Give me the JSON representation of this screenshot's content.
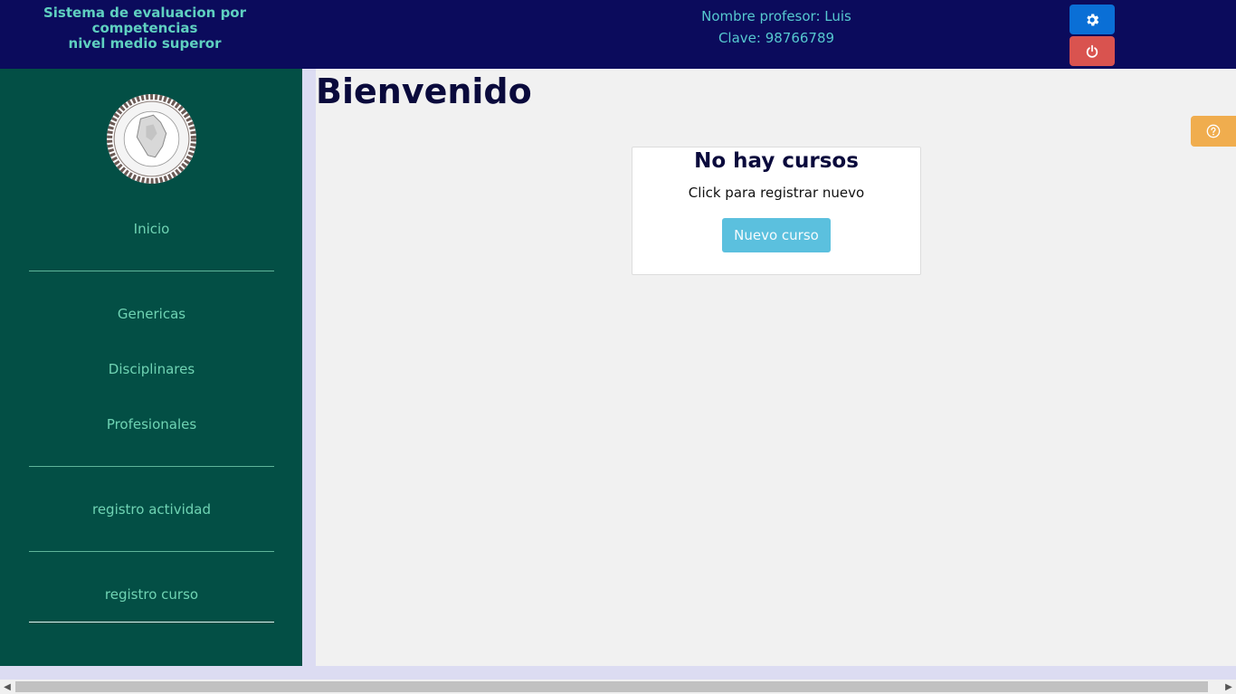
{
  "header": {
    "app_title_line1": "Sistema de evaluacion por competencias",
    "app_title_line2": "nivel medio superor",
    "teacher_name": "Nombre profesor: Luis",
    "teacher_key": "Clave: 98766789",
    "settings_icon": "gear-icon",
    "logout_icon": "power-icon"
  },
  "sidebar": {
    "logo": "school-seal-logo",
    "items": [
      {
        "label": "Inicio"
      },
      {
        "label": "Genericas"
      },
      {
        "label": "Disciplinares"
      },
      {
        "label": "Profesionales"
      },
      {
        "label": "registro actividad"
      },
      {
        "label": "registro curso"
      }
    ]
  },
  "main": {
    "title": "Bienvenido",
    "help_icon": "question-circle-icon",
    "card": {
      "title": "No hay cursos",
      "text": "Click para registrar nuevo",
      "button_label": "Nuevo curso"
    }
  },
  "colors": {
    "header_bg": "#0b0b5c",
    "sidebar_bg": "#034f45",
    "settings_btn": "#0a6fd6",
    "logout_btn": "#d9534f",
    "help_btn": "#f0ad4e",
    "primary_button": "#5bc0de"
  }
}
